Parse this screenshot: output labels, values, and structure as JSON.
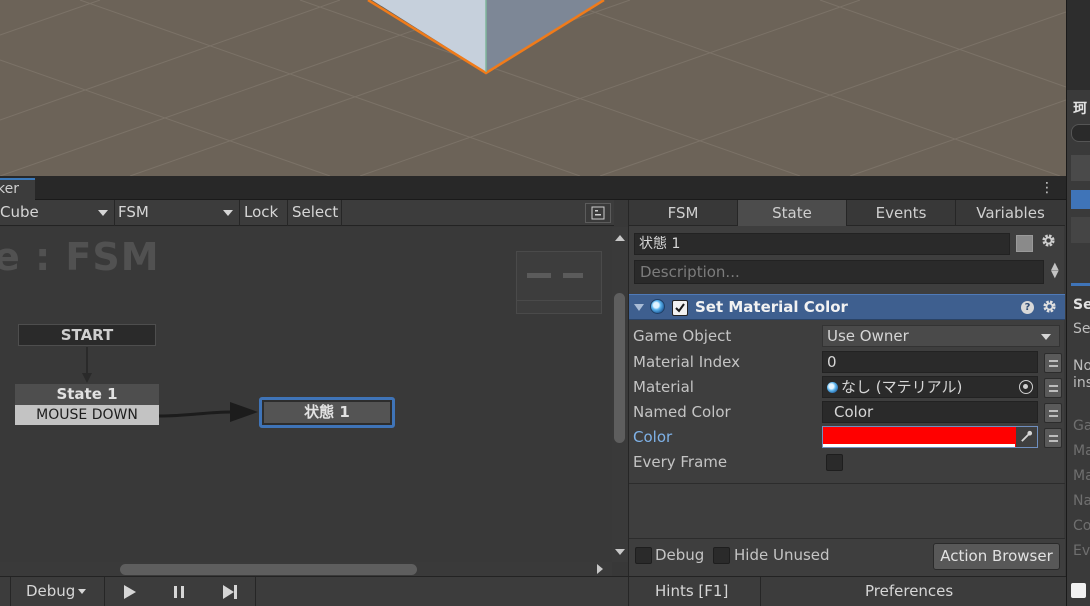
{
  "panel": {
    "tab_label": "ker",
    "menu_icon": "kebab-menu-icon"
  },
  "graph_toolbar": {
    "gameobject": "Cube",
    "fsm": "FSM",
    "lock": "Lock",
    "select": "Select",
    "settings_icon": "graph-settings-icon"
  },
  "graph": {
    "title": "e : FSM",
    "start_label": "START",
    "state1_name": "State 1",
    "state1_event": "MOUSE DOWN",
    "state2_name": "状態 1",
    "vertical_scroll": 0.3,
    "horizontal_scroll": 0.26
  },
  "inspector": {
    "tabs": [
      "FSM",
      "State",
      "Events",
      "Variables"
    ],
    "active_tab": "State",
    "state_name": "状態 1",
    "state_color": "#8a8a8a",
    "description_placeholder": "Description...",
    "action": {
      "title": "Set Material Color",
      "enabled": true,
      "help_symbol": "?",
      "properties": {
        "game_object": {
          "label": "Game Object",
          "value": "Use Owner"
        },
        "material_index": {
          "label": "Material Index",
          "value": "0"
        },
        "material": {
          "label": "Material",
          "value": "なし (マテリアル)"
        },
        "named_color": {
          "label": "Named Color",
          "value": "Color"
        },
        "color": {
          "label": "Color",
          "value_hex": "#ff0000"
        },
        "every_frame": {
          "label": "Every Frame",
          "checked": false
        }
      }
    },
    "footer": {
      "debug_label": "Debug",
      "debug_checked": false,
      "hide_unused_label": "Hide Unused",
      "hide_unused_checked": false,
      "action_browser": "Action Browser"
    }
  },
  "bottom_bar": {
    "debug": "Debug",
    "play_icon": "play-icon",
    "pause_icon": "pause-icon",
    "step_icon": "step-icon",
    "hints": "Hints [F1]",
    "preferences": "Preferences"
  },
  "right_strip": {
    "header_char": "珂",
    "bold_label": "Se",
    "line_se": "Se",
    "line_no": "No",
    "line_ins": "ins",
    "dim_lines": [
      "Ga",
      "Ma",
      "Ma",
      "Na",
      "Co",
      "Ev"
    ]
  },
  "colors": {
    "accent": "#3f74b8",
    "action_header": "#3e5f8f",
    "selection_outline": "#f07b1a",
    "color_swatch": "#ff0000"
  }
}
